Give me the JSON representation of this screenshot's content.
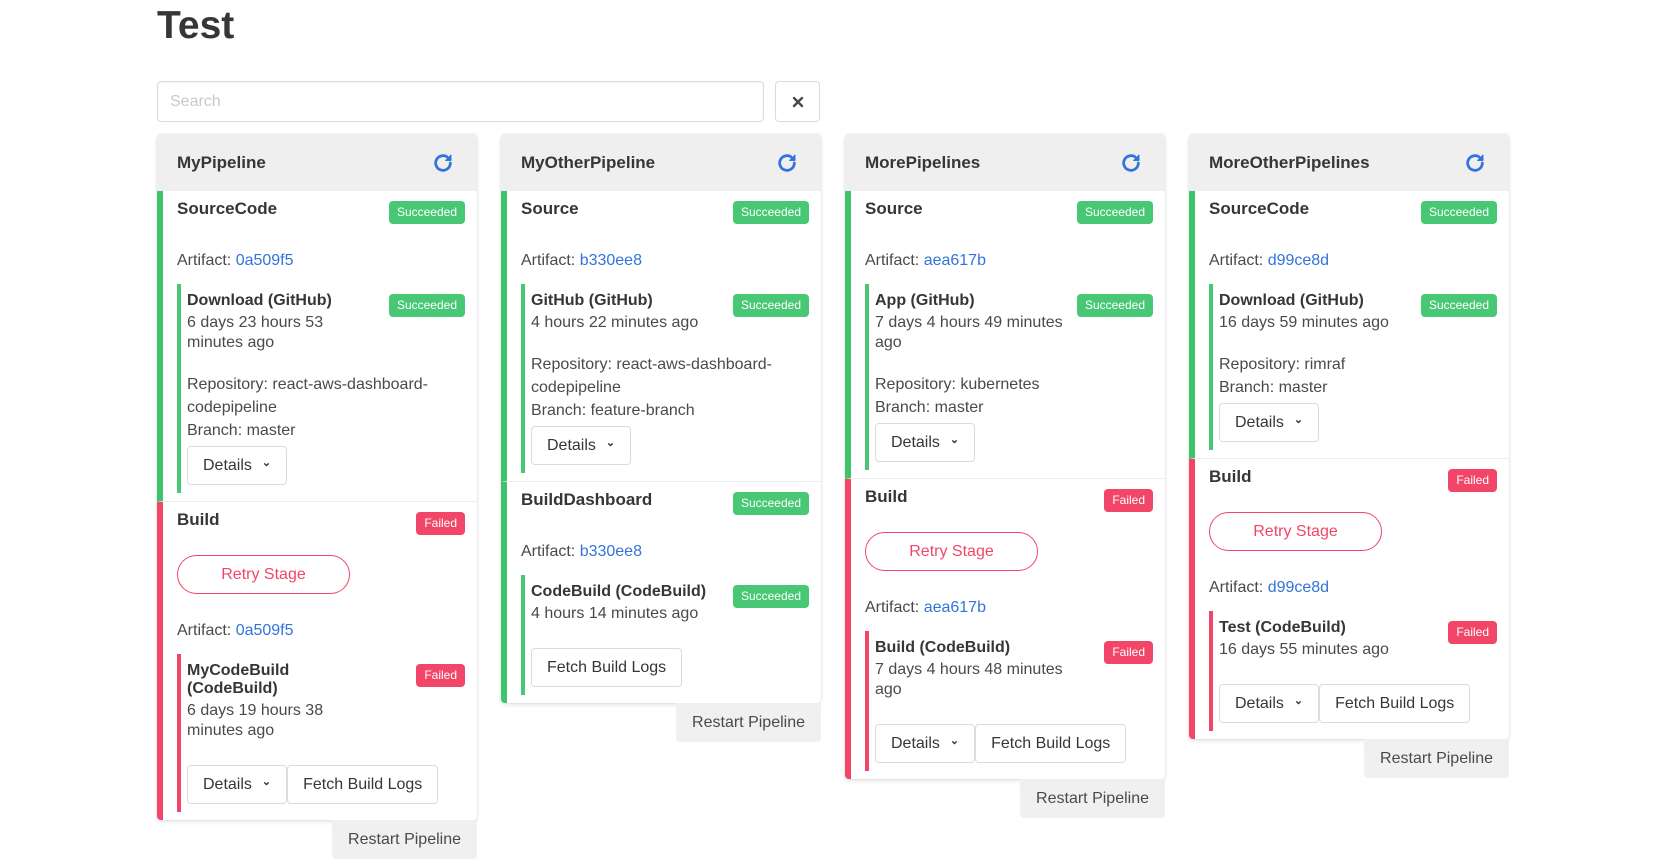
{
  "page_title": "Test",
  "search": {
    "placeholder": "Search",
    "value": ""
  },
  "colors": {
    "success": "#48c774",
    "danger": "#f14668",
    "link": "#3273dc",
    "refresh": "#3273dc"
  },
  "labels": {
    "succeeded": "Succeeded",
    "failed": "Failed",
    "artifact": "Artifact:",
    "details": "Details",
    "fetch_logs": "Fetch Build Logs",
    "retry_stage": "Retry Stage",
    "restart_pipeline": "Restart Pipeline"
  },
  "pipelines": [
    {
      "name": "MyPipeline",
      "stages": [
        {
          "name": "SourceCode",
          "status": "Succeeded",
          "artifact": "0a509f5",
          "action": {
            "name": "Download (GitHub)",
            "status": "Succeeded",
            "time": "6 days 23 hours 53 minutes ago",
            "lines": [
              "Repository: react-aws-dashboard-codepipeline",
              "Branch: master"
            ]
          }
        },
        {
          "name": "Build",
          "status": "Failed",
          "artifact": "0a509f5",
          "action": {
            "name": "MyCodeBuild (CodeBuild)",
            "status": "Failed",
            "time": "6 days 19 hours 38 minutes ago"
          }
        }
      ]
    },
    {
      "name": "MyOtherPipeline",
      "stages": [
        {
          "name": "Source",
          "status": "Succeeded",
          "artifact": "b330ee8",
          "action": {
            "name": "GitHub (GitHub)",
            "status": "Succeeded",
            "time": "4 hours 22 minutes ago",
            "lines": [
              "Repository: react-aws-dashboard-codepipeline",
              "Branch: feature-branch"
            ]
          }
        },
        {
          "name": "BuildDashboard",
          "status": "Succeeded",
          "artifact": "b330ee8",
          "action": {
            "name": "CodeBuild (CodeBuild)",
            "status": "Succeeded",
            "time": "4 hours 14 minutes ago"
          }
        }
      ]
    },
    {
      "name": "MorePipelines",
      "stages": [
        {
          "name": "Source",
          "status": "Succeeded",
          "artifact": "aea617b",
          "action": {
            "name": "App (GitHub)",
            "status": "Succeeded",
            "time": "7 days 4 hours 49 minutes ago",
            "lines": [
              "Repository: kubernetes",
              "Branch: master"
            ]
          }
        },
        {
          "name": "Build",
          "status": "Failed",
          "artifact": "aea617b",
          "action": {
            "name": "Build (CodeBuild)",
            "status": "Failed",
            "time": "7 days 4 hours 48 minutes ago"
          }
        }
      ]
    },
    {
      "name": "MoreOtherPipelines",
      "stages": [
        {
          "name": "SourceCode",
          "status": "Succeeded",
          "artifact": "d99ce8d",
          "action": {
            "name": "Download (GitHub)",
            "status": "Succeeded",
            "time": "16 days 59 minutes ago",
            "lines": [
              "Repository: rimraf",
              "Branch: master"
            ]
          }
        },
        {
          "name": "Build",
          "status": "Failed",
          "artifact": "d99ce8d",
          "action": {
            "name": "Test (CodeBuild)",
            "status": "Failed",
            "time": "16 days 55 minutes ago"
          }
        }
      ]
    }
  ]
}
